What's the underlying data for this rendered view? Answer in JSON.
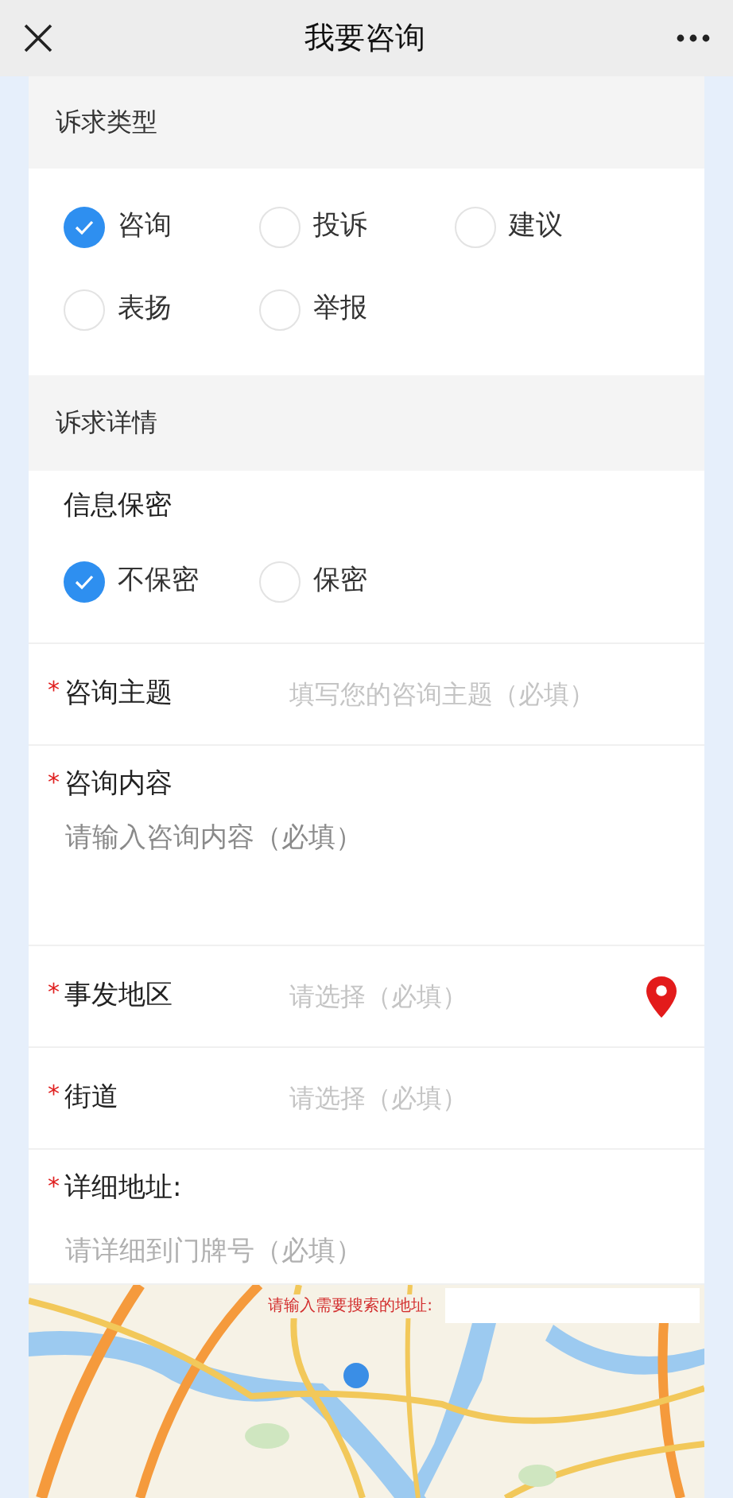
{
  "header": {
    "title": "我要咨询"
  },
  "type_section": {
    "title": "诉求类型",
    "options": [
      {
        "label": "咨询",
        "selected": true
      },
      {
        "label": "投诉",
        "selected": false
      },
      {
        "label": "建议",
        "selected": false
      },
      {
        "label": "表扬",
        "selected": false
      },
      {
        "label": "举报",
        "selected": false
      }
    ]
  },
  "detail_section": {
    "title": "诉求详情",
    "privacy": {
      "label": "信息保密",
      "options": [
        {
          "label": "不保密",
          "selected": true
        },
        {
          "label": "保密",
          "selected": false
        }
      ]
    },
    "fields": [
      {
        "kind": "inline",
        "mark": "*",
        "label": "咨询主题",
        "placeholder": "填写您的咨询主题（必填）"
      },
      {
        "kind": "area",
        "mark": "*",
        "label": "咨询内容",
        "placeholder": "请输入咨询内容（必填）"
      },
      {
        "kind": "location",
        "mark": "*",
        "label": "事发地区",
        "placeholder": "请选择（必填）"
      },
      {
        "kind": "inline",
        "mark": "*",
        "label": "街道",
        "placeholder": "请选择（必填）"
      },
      {
        "kind": "stacked",
        "mark": "*",
        "label": "详细地址:",
        "placeholder": "请详细到门牌号（必填）"
      }
    ]
  },
  "map": {
    "search_label": "请输入需要搜索的地址:"
  }
}
